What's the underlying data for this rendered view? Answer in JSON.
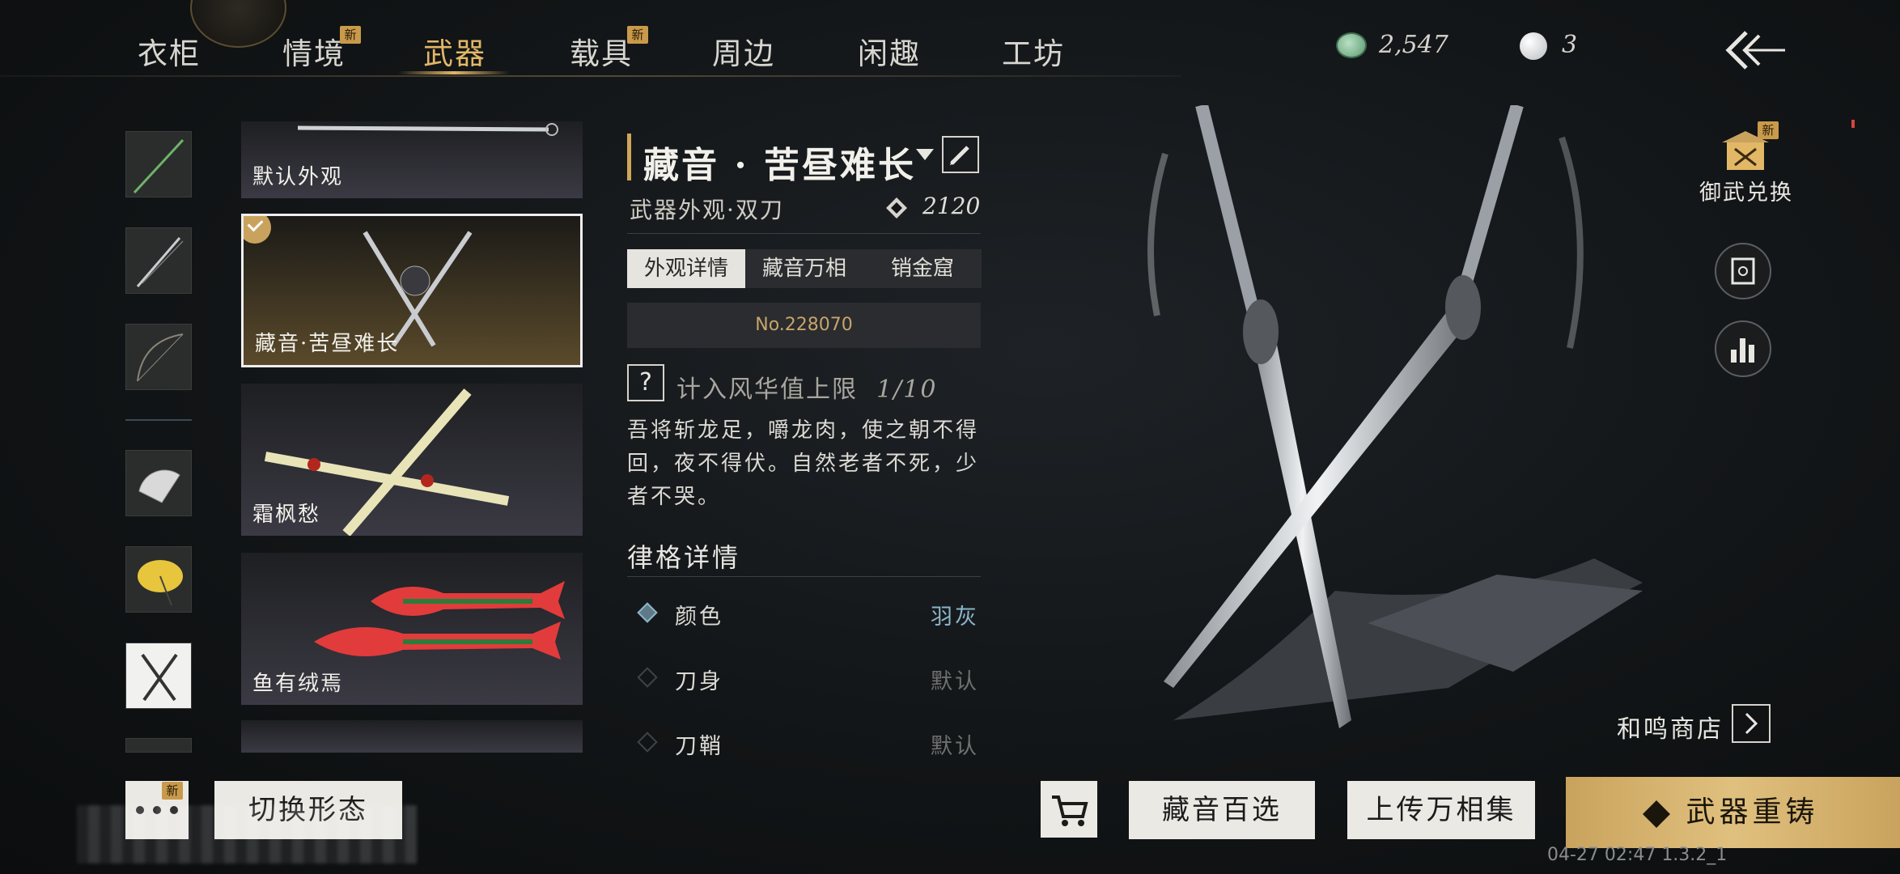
{
  "nav": {
    "tabs": [
      {
        "label": "衣柜",
        "new": false
      },
      {
        "label": "情境",
        "new": true
      },
      {
        "label": "武器",
        "new": false,
        "active": true
      },
      {
        "label": "载具",
        "new": true
      },
      {
        "label": "周边",
        "new": false
      },
      {
        "label": "闲趣",
        "new": false
      },
      {
        "label": "工坊",
        "new": false
      }
    ],
    "new_badge": "新",
    "currency_jade": "2,547",
    "currency_pearl": "3"
  },
  "cards": [
    {
      "label": "默认外观"
    },
    {
      "label": "藏音·苦昼难长",
      "selected": true
    },
    {
      "label": "霜枫愁"
    },
    {
      "label": "鱼有绒焉"
    }
  ],
  "detail": {
    "title": "藏音 · 苦昼难长",
    "subtitle": "武器外观·双刀",
    "score": "2120",
    "tabs": [
      "外观详情",
      "藏音万相",
      "销金窟"
    ],
    "serial": "No.228070",
    "question_mark": "?",
    "limit_label": "计入风华值上限",
    "limit_value": "1/10",
    "description": "吾将斩龙足，嚼龙肉，使之朝不得回，夜不得伏。自然老者不死，少者不哭。",
    "section_title": "律格详情",
    "attributes": [
      {
        "name": "颜色",
        "value": "羽灰",
        "active": true
      },
      {
        "name": "刀身",
        "value": "默认",
        "active": false
      },
      {
        "name": "刀鞘",
        "value": "默认",
        "active": false
      }
    ]
  },
  "side": {
    "exchange_label": "御武兑换",
    "shop_label": "和鸣商店"
  },
  "bottom": {
    "switch_form": "切换形态",
    "collection": "藏音百选",
    "upload": "上传万相集",
    "reforge": "武器重铸",
    "timestamp": "04-27 02:47 1.3.2_1"
  },
  "colors": {
    "accent_gold": "#e2b766",
    "attr_active": "#8bb5c9"
  }
}
